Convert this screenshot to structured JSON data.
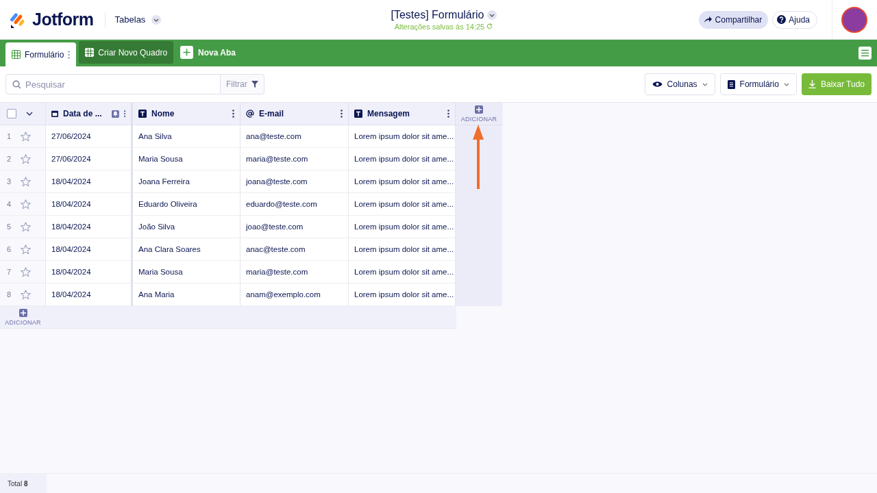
{
  "header": {
    "logo": "Jotform",
    "section": "Tabelas",
    "title": "[Testes] Formulário",
    "saved": "Alterações salvas às 14:25",
    "share": "Compartilhar",
    "help": "Ajuda"
  },
  "tabs": [
    {
      "label": "Formulário",
      "selected": true
    },
    {
      "label": "Criar Novo Quadro",
      "selected": false
    }
  ],
  "new_tab": "Nova Aba",
  "toolbar": {
    "search_placeholder": "Pesquisar",
    "filter": "Filtrar",
    "columns": "Colunas",
    "form": "Formulário",
    "download": "Baixar Tudo"
  },
  "table": {
    "select_all_checked": false,
    "columns": [
      {
        "label": "Data de ...",
        "kind": "date"
      },
      {
        "label": "Nome",
        "kind": "text"
      },
      {
        "label": "E-mail",
        "kind": "email"
      },
      {
        "label": "Mensagem",
        "kind": "text"
      }
    ],
    "add_column": "ADICIONAR",
    "add_row": "ADICIONAR",
    "rows": [
      {
        "n": "1",
        "starred": false,
        "cells": [
          "27/06/2024",
          "Ana Silva",
          "ana@teste.com",
          "Lorem ipsum dolor sit ame..."
        ]
      },
      {
        "n": "2",
        "starred": false,
        "cells": [
          "27/06/2024",
          "Maria Sousa",
          "maria@teste.com",
          "Lorem ipsum dolor sit ame..."
        ]
      },
      {
        "n": "3",
        "starred": false,
        "cells": [
          "18/04/2024",
          "Joana Ferreira",
          "joana@teste.com",
          "Lorem ipsum dolor sit ame..."
        ]
      },
      {
        "n": "4",
        "starred": false,
        "cells": [
          "18/04/2024",
          "Eduardo Oliveira",
          "eduardo@teste.com",
          "Lorem ipsum dolor sit ame..."
        ]
      },
      {
        "n": "5",
        "starred": false,
        "cells": [
          "18/04/2024",
          "João Silva",
          "joao@teste.com",
          "Lorem ipsum dolor sit ame..."
        ]
      },
      {
        "n": "6",
        "starred": false,
        "cells": [
          "18/04/2024",
          "Ana Clara Soares",
          "anac@teste.com",
          "Lorem ipsum dolor sit ame..."
        ]
      },
      {
        "n": "7",
        "starred": false,
        "cells": [
          "18/04/2024",
          "Maria Sousa",
          "maria@teste.com",
          "Lorem ipsum dolor sit ame..."
        ]
      },
      {
        "n": "8",
        "starred": false,
        "cells": [
          "18/04/2024",
          "Ana Maria",
          "anam@exemplo.com",
          "Lorem ipsum dolor sit ame..."
        ]
      }
    ]
  },
  "footer": {
    "total": "Total **8**"
  }
}
